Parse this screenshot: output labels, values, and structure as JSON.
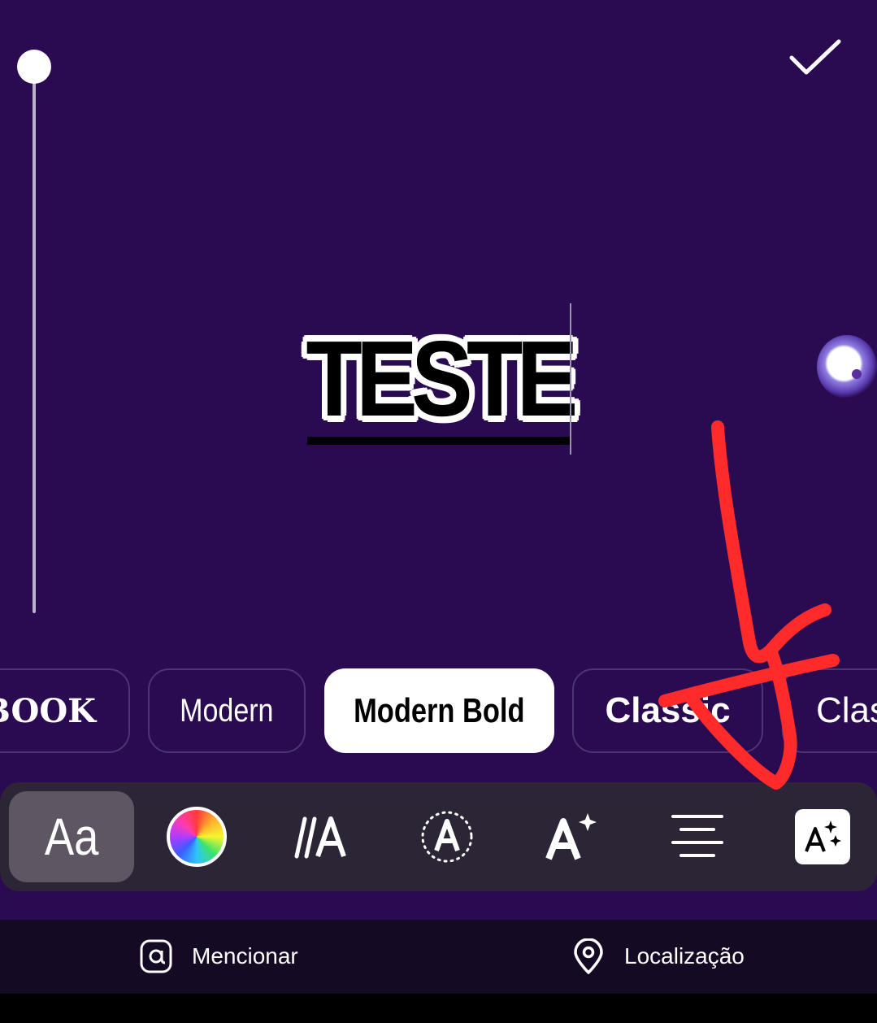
{
  "canvas": {
    "text": "TESTE"
  },
  "header": {
    "done_icon": "checkmark-icon"
  },
  "font_styles": {
    "items": [
      {
        "label": "RBOOK",
        "selected": false
      },
      {
        "label": "Modern",
        "selected": false
      },
      {
        "label": "Modern Bold",
        "selected": true
      },
      {
        "label": "Classic",
        "selected": false
      },
      {
        "label": "Clas",
        "selected": false
      }
    ]
  },
  "toolbar": {
    "font_label": "Aa",
    "tools": [
      "font",
      "color-picker",
      "text-animation",
      "text-effects",
      "text-style-sparkle",
      "text-align",
      "text-effects-sparkle"
    ]
  },
  "bottom_bar": {
    "mention_label": "Mencionar",
    "location_label": "Localização"
  },
  "colors": {
    "background": "#2a0b52",
    "annotation": "#ff2b2b",
    "toolbar": "#2b2535"
  }
}
